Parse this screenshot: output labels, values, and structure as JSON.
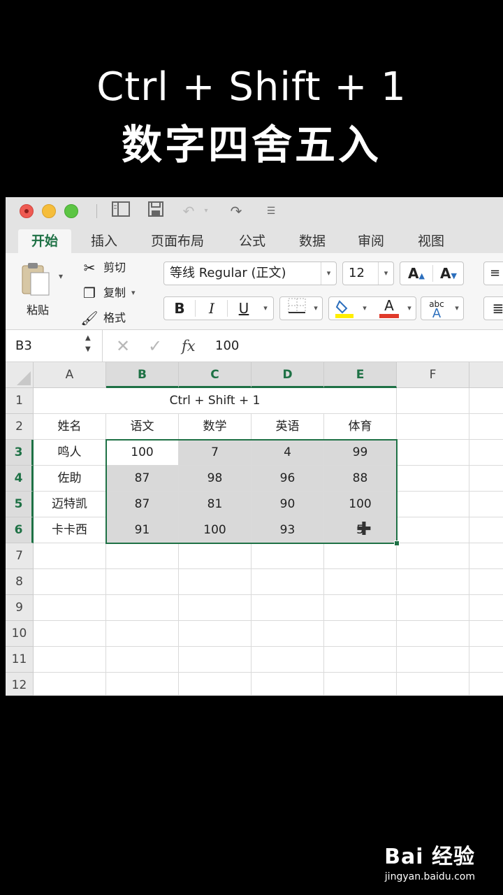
{
  "caption": {
    "line1": "Ctrl + Shift + 1",
    "line2": "数字四舍五入"
  },
  "tabs": [
    {
      "label": "开始",
      "active": true
    },
    {
      "label": "插入"
    },
    {
      "label": "页面布局"
    },
    {
      "label": "公式"
    },
    {
      "label": "数据"
    },
    {
      "label": "审阅"
    },
    {
      "label": "视图"
    }
  ],
  "ribbon": {
    "paste_label": "粘贴",
    "cut_label": "剪切",
    "copy_label": "复制",
    "format_label": "格式",
    "font_name": "等线 Regular (正文)",
    "font_size": "12",
    "bold": "B",
    "italic": "I",
    "underline": "U",
    "font_color_glyph": "A",
    "phonetic_top": "abc",
    "phonetic_bottom": "A",
    "grow_font": "A",
    "shrink_font": "A",
    "fill_color": "#ffee00",
    "font_color": "#e03a2b"
  },
  "formula_bar": {
    "name_box": "B3",
    "fx": "fx",
    "value": "100"
  },
  "columns": [
    "A",
    "B",
    "C",
    "D",
    "E",
    "F"
  ],
  "rows": [
    "1",
    "2",
    "3",
    "4",
    "5",
    "6",
    "7",
    "8",
    "9",
    "10",
    "11",
    "12"
  ],
  "sheet": {
    "title": "Ctrl + Shift + 1",
    "headers": [
      "姓名",
      "语文",
      "数学",
      "英语",
      "体育"
    ],
    "data": [
      [
        "鸣人",
        "100",
        "7",
        "4",
        "99"
      ],
      [
        "佐助",
        "87",
        "98",
        "96",
        "88"
      ],
      [
        "迈特凯",
        "87",
        "81",
        "90",
        "100"
      ],
      [
        "卡卡西",
        "91",
        "100",
        "93",
        "5"
      ]
    ]
  },
  "accent_color": "#1e7145",
  "watermark": {
    "logo": "Bai 经验",
    "url": "jingyan.baidu.com"
  }
}
